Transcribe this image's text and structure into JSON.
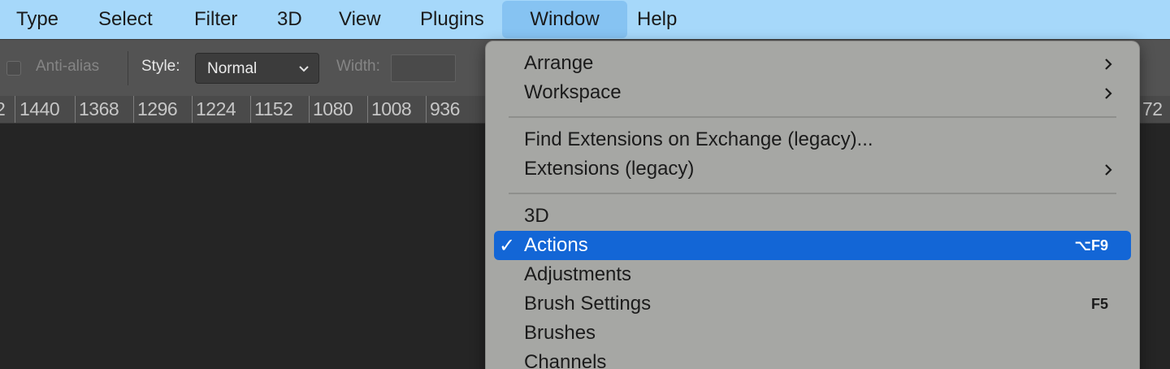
{
  "menubar": {
    "items": [
      "Type",
      "Select",
      "Filter",
      "3D",
      "View",
      "Plugins",
      "Window",
      "Help"
    ],
    "active": "Window"
  },
  "options": {
    "anti_alias_label": "Anti-alias",
    "style_label": "Style:",
    "style_value": "Normal",
    "width_label": "Width:",
    "width_value": ""
  },
  "ruler": {
    "labels": [
      "2",
      "1440",
      "1368",
      "1296",
      "1224",
      "1152",
      "1080",
      "1008",
      "936",
      "72"
    ]
  },
  "window_menu": {
    "groups": [
      [
        {
          "label": "Arrange",
          "submenu": true
        },
        {
          "label": "Workspace",
          "submenu": true
        }
      ],
      [
        {
          "label": "Find Extensions on Exchange (legacy)...",
          "submenu": false
        },
        {
          "label": "Extensions (legacy)",
          "submenu": true
        }
      ],
      [
        {
          "label": "3D"
        },
        {
          "label": "Actions",
          "checked": true,
          "highlighted": true,
          "shortcut": "⌥F9"
        },
        {
          "label": "Adjustments"
        },
        {
          "label": "Brush Settings",
          "shortcut": "F5"
        },
        {
          "label": "Brushes"
        },
        {
          "label": "Channels"
        }
      ]
    ],
    "check_glyph": "✓"
  },
  "icons": {
    "submenu_arrow": "chevron-right-icon",
    "select_arrow": "chevron-down-icon"
  },
  "colors": {
    "menubar_bg": "#a6d8fa",
    "menu_highlight": "#1366d6",
    "menu_bg": "#a6a7a4"
  }
}
